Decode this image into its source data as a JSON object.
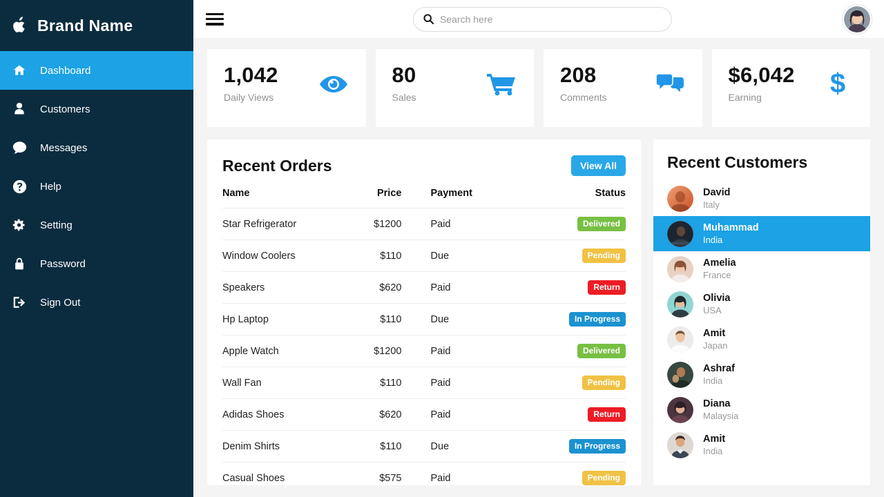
{
  "sidebar": {
    "brand": {
      "logo_icon": "apple-icon",
      "name": "Brand Name"
    },
    "items": [
      {
        "label": "Dashboard",
        "icon": "home-icon",
        "active": true
      },
      {
        "label": "Customers",
        "icon": "user-icon",
        "active": false
      },
      {
        "label": "Messages",
        "icon": "comment-icon",
        "active": false
      },
      {
        "label": "Help",
        "icon": "question-circle-icon",
        "active": false
      },
      {
        "label": "Setting",
        "icon": "gear-icon",
        "active": false
      },
      {
        "label": "Password",
        "icon": "lock-icon",
        "active": false
      },
      {
        "label": "Sign Out",
        "icon": "sign-out-icon",
        "active": false
      }
    ],
    "background_color": "#0b2c3f",
    "active_color": "#1ca2e5"
  },
  "topbar": {
    "menu_icon": "hamburger-icon",
    "search": {
      "placeholder": "Search here",
      "value": "",
      "icon": "search-icon"
    },
    "avatar_icon": "user-avatar"
  },
  "stats": [
    {
      "value": "1,042",
      "label": "Daily Views",
      "icon": "eye-icon"
    },
    {
      "value": "80",
      "label": "Sales",
      "icon": "shopping-cart-icon"
    },
    {
      "value": "208",
      "label": "Comments",
      "icon": "comments-icon"
    },
    {
      "value": "$6,042",
      "label": "Earning",
      "icon": "dollar-icon"
    }
  ],
  "orders": {
    "title": "Recent Orders",
    "view_all_label": "View All",
    "columns": [
      "Name",
      "Price",
      "Payment",
      "Status"
    ],
    "rows": [
      {
        "name": "Star Refrigerator",
        "price": "$1200",
        "payment": "Paid",
        "status": "Delivered",
        "status_class": "delivered"
      },
      {
        "name": "Window Coolers",
        "price": "$110",
        "payment": "Due",
        "status": "Pending",
        "status_class": "pending"
      },
      {
        "name": "Speakers",
        "price": "$620",
        "payment": "Paid",
        "status": "Return",
        "status_class": "return"
      },
      {
        "name": "Hp Laptop",
        "price": "$110",
        "payment": "Due",
        "status": "In Progress",
        "status_class": "progress"
      },
      {
        "name": "Apple Watch",
        "price": "$1200",
        "payment": "Paid",
        "status": "Delivered",
        "status_class": "delivered"
      },
      {
        "name": "Wall Fan",
        "price": "$110",
        "payment": "Paid",
        "status": "Pending",
        "status_class": "pending"
      },
      {
        "name": "Adidas Shoes",
        "price": "$620",
        "payment": "Paid",
        "status": "Return",
        "status_class": "return"
      },
      {
        "name": "Denim Shirts",
        "price": "$110",
        "payment": "Due",
        "status": "In Progress",
        "status_class": "progress"
      },
      {
        "name": "Casual Shoes",
        "price": "$575",
        "payment": "Paid",
        "status": "Pending",
        "status_class": "pending"
      }
    ]
  },
  "customers": {
    "title": "Recent Customers",
    "rows": [
      {
        "name": "David",
        "country": "Italy",
        "active": false,
        "avatar_colors": [
          "#d96a3a",
          "#f0a070"
        ]
      },
      {
        "name": "Muhammad",
        "country": "India",
        "active": true,
        "avatar_colors": [
          "#20303c",
          "#3a4a58"
        ]
      },
      {
        "name": "Amelia",
        "country": "France",
        "active": false,
        "avatar_colors": [
          "#c9a390",
          "#e8d2c4"
        ]
      },
      {
        "name": "Olivia",
        "country": "USA",
        "active": false,
        "avatar_colors": [
          "#63c5c0",
          "#9fdedb"
        ]
      },
      {
        "name": "Amit",
        "country": "Japan",
        "active": false,
        "avatar_colors": [
          "#d8d5d0",
          "#efeeec"
        ]
      },
      {
        "name": "Ashraf",
        "country": "India",
        "active": false,
        "avatar_colors": [
          "#2c4038",
          "#4e6a5c"
        ]
      },
      {
        "name": "Diana",
        "country": "Malaysia",
        "active": false,
        "avatar_colors": [
          "#4b3540",
          "#7c5f6b"
        ]
      },
      {
        "name": "Amit",
        "country": "India",
        "active": false,
        "avatar_colors": [
          "#bfb8ae",
          "#ddd8d1"
        ]
      }
    ]
  },
  "colors": {
    "accent": "#1ca2e5",
    "sidebar": "#0b2c3f",
    "page_background": "#f4f4f4",
    "card": "#ffffff",
    "delivered": "#77c043",
    "pending": "#f0c244",
    "return": "#ed1c24",
    "in_progress": "#1b92d1"
  }
}
